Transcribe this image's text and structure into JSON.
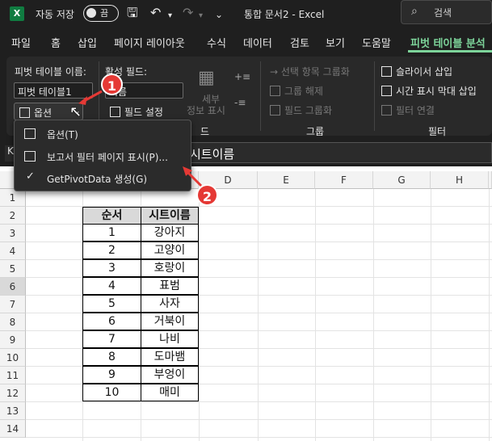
{
  "titlebar": {
    "app_letter": "X",
    "autosave_label": "자동 저장",
    "toggle_state": "끔",
    "doc_title": "통합 문서2  -  Excel",
    "search_placeholder": "검색"
  },
  "tabs": [
    "파일",
    "홈",
    "삽입",
    "페이지 레이아웃",
    "수식",
    "데이터",
    "검토",
    "보기",
    "도움말",
    "피벗 테이블 분석"
  ],
  "active_tab": "피벗 테이블 분석",
  "ribbon": {
    "pivot_name_label": "피벗 테이블 이름:",
    "pivot_name_value": "피벗 테이블1",
    "options_button": "옵션",
    "active_field_label": "활성 필드:",
    "active_field_value": "이름",
    "field_settings": "필드 설정",
    "detail_line1": "세부",
    "detail_line2": "정보 표시",
    "group_sel": "선택 항목 그룹화",
    "ungroup": "그룹 해제",
    "group_field": "필드 그룹화",
    "group_label": "그룹",
    "slicer": "슬라이서 삽입",
    "timeline": "시간 표시 막대 삽입",
    "filter_conn": "필터 연결",
    "filter_label": "필터",
    "field_group_label": "드"
  },
  "formula_bar": {
    "name_box": "K",
    "content": "시트이름"
  },
  "dropdown": {
    "items": [
      "옵션(T)",
      "보고서 필터 페이지 표시(P)...",
      "GetPivotData 생성(G)"
    ]
  },
  "columns": [
    "D",
    "E",
    "F",
    "G",
    "H"
  ],
  "rows": [
    "1",
    "2",
    "3",
    "4",
    "5",
    "6",
    "7",
    "8",
    "9",
    "10",
    "11",
    "12",
    "13",
    "14"
  ],
  "selected_row": "6",
  "table": {
    "headers": [
      "순서",
      "시트이름"
    ],
    "rows": [
      [
        "1",
        "강아지"
      ],
      [
        "2",
        "고양이"
      ],
      [
        "3",
        "호랑이"
      ],
      [
        "4",
        "표범"
      ],
      [
        "5",
        "사자"
      ],
      [
        "6",
        "거북이"
      ],
      [
        "7",
        "나비"
      ],
      [
        "8",
        "도마뱀"
      ],
      [
        "9",
        "부엉이"
      ],
      [
        "10",
        "매미"
      ]
    ]
  },
  "badges": [
    "1",
    "2"
  ],
  "colors": {
    "accent": "#7dd49a",
    "badge": "#e53935",
    "excel_green": "#107c41"
  }
}
